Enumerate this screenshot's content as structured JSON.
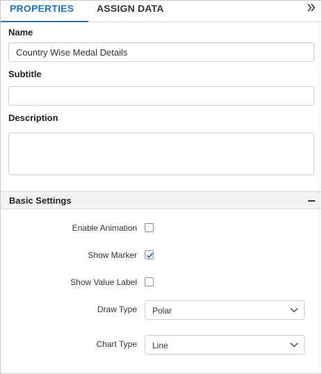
{
  "tabs": {
    "properties": "PROPERTIES",
    "assign_data": "ASSIGN DATA"
  },
  "icons": {
    "collapse": "double-chevron-right-icon",
    "section_toggle": "minus-icon",
    "check": "checkmark-icon",
    "dropdown": "chevron-down-icon"
  },
  "colors": {
    "accent": "#1a73d9",
    "section_bg": "#f3f3f3"
  },
  "form": {
    "name_label": "Name",
    "name_value": "Country Wise Medal Details",
    "subtitle_label": "Subtitle",
    "subtitle_value": "",
    "description_label": "Description",
    "description_value": ""
  },
  "basic_settings": {
    "title": "Basic Settings",
    "enable_animation": {
      "label": "Enable Animation",
      "checked": false
    },
    "show_marker": {
      "label": "Show Marker",
      "checked": true
    },
    "show_value_label": {
      "label": "Show Value Label",
      "checked": false
    },
    "draw_type": {
      "label": "Draw Type",
      "value": "Polar"
    },
    "chart_type": {
      "label": "Chart Type",
      "value": "Line"
    }
  }
}
